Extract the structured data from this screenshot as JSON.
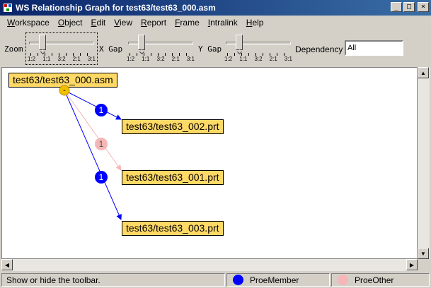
{
  "window": {
    "title": "WS Relationship Graph for test63/test63_000.asm",
    "controls": {
      "minimize": "_",
      "maximize": "□",
      "close": "×"
    }
  },
  "menubar": [
    {
      "label": "Workspace",
      "mnemonic": "W"
    },
    {
      "label": "Object",
      "mnemonic": "O"
    },
    {
      "label": "Edit",
      "mnemonic": "E"
    },
    {
      "label": "View",
      "mnemonic": "V"
    },
    {
      "label": "Report",
      "mnemonic": "R"
    },
    {
      "label": "Frame",
      "mnemonic": "F"
    },
    {
      "label": "Intralink",
      "mnemonic": "I"
    },
    {
      "label": "Help",
      "mnemonic": "H"
    }
  ],
  "toolbar": {
    "zoom_label": "Zoom",
    "xgap_label": "X Gap",
    "ygap_label": "Y Gap",
    "dependency_label": "Dependency",
    "dependency_value": "All",
    "zoom_ticks": [
      "1:2",
      "1:1",
      "3:2",
      "2:1",
      "3:1"
    ],
    "gap_ticks": [
      "1:2",
      "1:1",
      "3:2",
      "2:1",
      "3:1"
    ],
    "zoom_level": "1:1",
    "xgap_level": "1:1",
    "ygap_level": "1:1"
  },
  "graph": {
    "root": {
      "label": "test63/test63_000.asm",
      "badge": "-"
    },
    "children": [
      {
        "label": "test63/test63_002.prt",
        "count": "1",
        "type": "ProeMember"
      },
      {
        "label": "test63/test63_001.prt",
        "count": "1",
        "type": "ProeOther"
      },
      {
        "label": "test63/test63_003.prt",
        "count": "1",
        "type": "ProeMember"
      }
    ]
  },
  "colors": {
    "node_fill": "#ffd966",
    "root_badge": "#f0c000",
    "proe_member": "#0000ff",
    "proe_other": "#f4b6b6",
    "title_bar": "#0a246a"
  },
  "statusbar": {
    "message": "Show or hide the toolbar.",
    "legend": [
      {
        "label": "ProeMember",
        "color": "#0000ff"
      },
      {
        "label": "ProeOther",
        "color": "#f4b6b6"
      }
    ]
  }
}
